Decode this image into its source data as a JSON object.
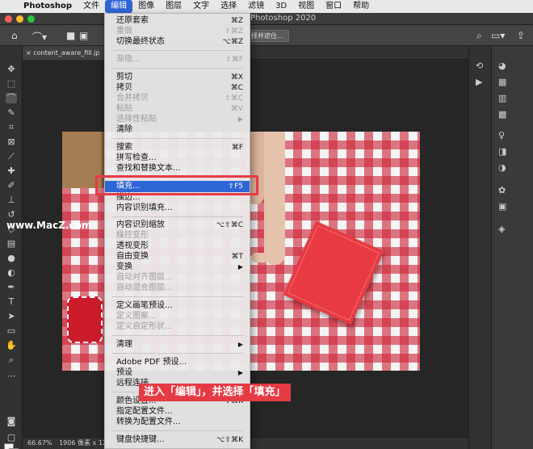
{
  "menubar": {
    "items": [
      "Photoshop",
      "文件",
      "编辑",
      "图像",
      "图层",
      "文字",
      "选择",
      "滤镜",
      "3D",
      "视图",
      "窗口",
      "帮助"
    ]
  },
  "window": {
    "title": "Photoshop 2020"
  },
  "options_bar": {
    "select_subject_label": "择并遮住..."
  },
  "document": {
    "tab_label": "content_aware_fill.jp",
    "zoom": "66.67%",
    "info": "1906 像素 x 127"
  },
  "watermark": "www.MacZ.com",
  "caption": "进入「编辑」，并选择「填充」",
  "colors": {
    "menu_highlight": "#2f66d6",
    "annotation_red": "#e63b44"
  },
  "edit_menu": {
    "items": [
      {
        "label": "还原套索",
        "shortcut": "⌘Z",
        "disabled": false
      },
      {
        "label": "重做",
        "shortcut": "⇧⌘Z",
        "disabled": true
      },
      {
        "label": "切换最终状态",
        "shortcut": "⌥⌘Z",
        "disabled": false
      },
      {
        "label": "渐隐...",
        "shortcut": "⇧⌘F",
        "disabled": true
      },
      {
        "label": "剪切",
        "shortcut": "⌘X",
        "disabled": false
      },
      {
        "label": "拷贝",
        "shortcut": "⌘C",
        "disabled": false
      },
      {
        "label": "合并拷贝",
        "shortcut": "⇧⌘C",
        "disabled": true
      },
      {
        "label": "粘贴",
        "shortcut": "⌘V",
        "disabled": true
      },
      {
        "label": "选择性粘贴",
        "shortcut": "▶",
        "disabled": true
      },
      {
        "label": "清除",
        "shortcut": "",
        "disabled": false
      },
      {
        "label": "搜索",
        "shortcut": "⌘F",
        "disabled": false
      },
      {
        "label": "拼写检查...",
        "shortcut": "",
        "disabled": false
      },
      {
        "label": "查找和替换文本...",
        "shortcut": "",
        "disabled": false
      },
      {
        "label": "填充...",
        "shortcut": "⇧F5",
        "disabled": false
      },
      {
        "label": "描边...",
        "shortcut": "",
        "disabled": false
      },
      {
        "label": "内容识别填充...",
        "shortcut": "",
        "disabled": false
      },
      {
        "label": "内容识别缩放",
        "shortcut": "⌥⇧⌘C",
        "disabled": false
      },
      {
        "label": "操控变形",
        "shortcut": "",
        "disabled": true
      },
      {
        "label": "透视变形",
        "shortcut": "",
        "disabled": false
      },
      {
        "label": "自由变换",
        "shortcut": "⌘T",
        "disabled": false
      },
      {
        "label": "变换",
        "shortcut": "▶",
        "disabled": false
      },
      {
        "label": "自动对齐图层...",
        "shortcut": "",
        "disabled": true
      },
      {
        "label": "自动混合图层...",
        "shortcut": "",
        "disabled": true
      },
      {
        "label": "定义画笔预设...",
        "shortcut": "",
        "disabled": false
      },
      {
        "label": "定义图案...",
        "shortcut": "",
        "disabled": true
      },
      {
        "label": "定义自定形状...",
        "shortcut": "",
        "disabled": true
      },
      {
        "label": "清理",
        "shortcut": "▶",
        "disabled": false
      },
      {
        "label": "Adobe PDF 预设...",
        "shortcut": "",
        "disabled": false
      },
      {
        "label": "预设",
        "shortcut": "▶",
        "disabled": false
      },
      {
        "label": "远程连接...",
        "shortcut": "",
        "disabled": false
      },
      {
        "label": "颜色设置...",
        "shortcut": "⇧⌘K",
        "disabled": false
      },
      {
        "label": "指定配置文件...",
        "shortcut": "",
        "disabled": false
      },
      {
        "label": "转换为配置文件...",
        "shortcut": "",
        "disabled": false
      },
      {
        "label": "键盘快捷键...",
        "shortcut": "⌥⇧⌘K",
        "disabled": false
      }
    ]
  }
}
